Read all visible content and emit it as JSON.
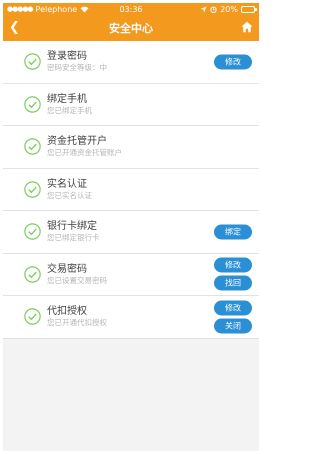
{
  "status": {
    "carrier": "Pelephone",
    "time": "03:36",
    "battery": "20%",
    "battery_level": 0.2
  },
  "header": {
    "title": "安全中心",
    "back_icon": "chevron-left-icon",
    "home_icon": "home-icon"
  },
  "colors": {
    "accent": "#f39a1e",
    "button": "#2a8fd4",
    "check": "#7ccd5a"
  },
  "items": [
    {
      "title": "登录密码",
      "subtitle": "密码安全等级：中",
      "buttons": [
        "修改"
      ]
    },
    {
      "title": "绑定手机",
      "subtitle": "您已绑定手机",
      "buttons": []
    },
    {
      "title": "资金托管开户",
      "subtitle": "您已开通资金托管账户",
      "buttons": []
    },
    {
      "title": "实名认证",
      "subtitle": "您已实名认证",
      "buttons": []
    },
    {
      "title": "银行卡绑定",
      "subtitle": "您已绑定银行卡",
      "buttons": [
        "绑定"
      ]
    },
    {
      "title": "交易密码",
      "subtitle": "您已设置交易密码",
      "buttons": [
        "修改",
        "找回"
      ]
    },
    {
      "title": "代扣授权",
      "subtitle": "您已开通代扣授权",
      "buttons": [
        "修改",
        "关闭"
      ]
    }
  ]
}
